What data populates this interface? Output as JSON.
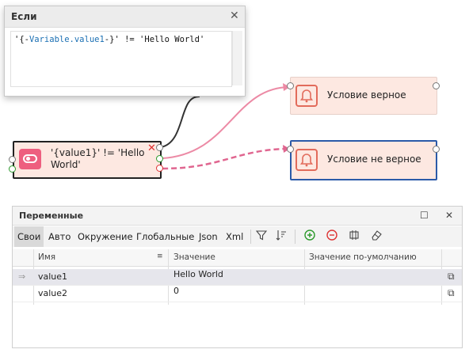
{
  "condition_panel": {
    "title": "Если",
    "close_glyph": "✕",
    "code_prefix": "'{-",
    "code_var": "Variable.value1",
    "code_suffix": "-}' != 'Hello World'"
  },
  "if_node": {
    "label_line1": "'{value1}' != 'Hello",
    "label_line2": "World'",
    "delete_glyph": "✕",
    "icon": "toggle-icon"
  },
  "true_node": {
    "label": "Условие верное",
    "icon": "bell-icon"
  },
  "false_node": {
    "label": "Условие не верное",
    "icon": "bell-icon"
  },
  "colors": {
    "node_bg": "#fde8e1",
    "accent": "#e26b5b",
    "if_icon": "#ee5f7f",
    "link": "#ec8aa5",
    "selected_border": "#2b5aa8"
  },
  "variables_panel": {
    "title": "Переменные",
    "tabs": [
      "Свои",
      "Авто",
      "Окружение",
      "Глобальные",
      "Json",
      "Xml"
    ],
    "active_tab": "Свои",
    "toolbar_icons": [
      "filter-icon",
      "sort-icon",
      "add-icon",
      "remove-icon",
      "clear-icon",
      "eraser-icon"
    ],
    "columns": {
      "name": "Имя",
      "value": "Значение",
      "default": "Значение по-умолчанию"
    },
    "rows": [
      {
        "name": "value1",
        "value": "Hello World",
        "default": ""
      },
      {
        "name": "value2",
        "value": "0",
        "default": ""
      }
    ]
  }
}
